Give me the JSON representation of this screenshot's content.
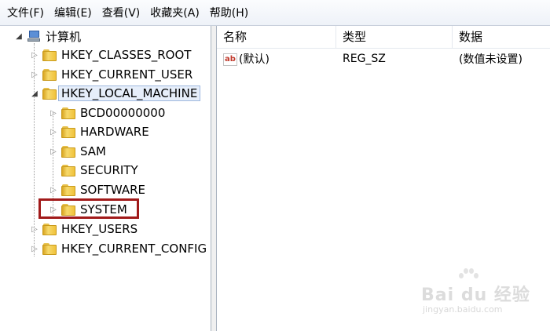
{
  "menubar": {
    "items": [
      "文件(F)",
      "编辑(E)",
      "查看(V)",
      "收藏夹(A)",
      "帮助(H)"
    ]
  },
  "tree": {
    "root": "计算机",
    "hives": {
      "classes_root": "HKEY_CLASSES_ROOT",
      "current_user": "HKEY_CURRENT_USER",
      "local_machine": "HKEY_LOCAL_MACHINE",
      "users": "HKEY_USERS",
      "current_config": "HKEY_CURRENT_CONFIG"
    },
    "local_machine_children": [
      "BCD00000000",
      "HARDWARE",
      "SAM",
      "SECURITY",
      "SOFTWARE",
      "SYSTEM"
    ],
    "highlighted": "SYSTEM"
  },
  "list": {
    "headers": {
      "name": "名称",
      "type": "类型",
      "data": "数据"
    },
    "rows": [
      {
        "name": "(默认)",
        "type": "REG_SZ",
        "data": "(数值未设置)",
        "icon": "ab-icon"
      }
    ]
  },
  "watermark": {
    "brand": "Bai du 经验",
    "domain": "jingyan.baidu.com"
  }
}
